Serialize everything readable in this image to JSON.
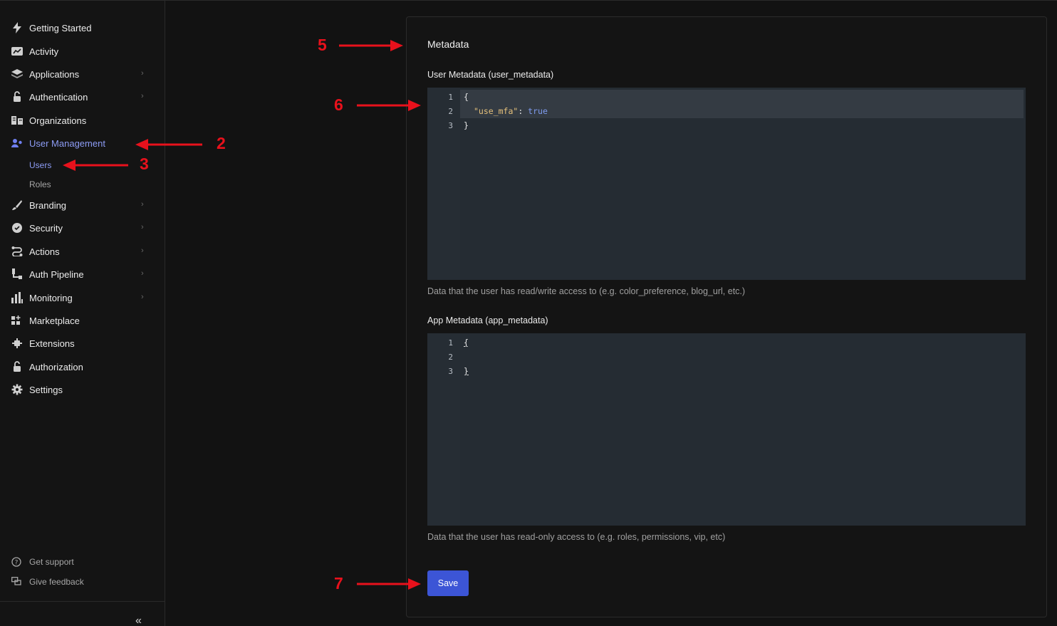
{
  "sidebar": {
    "items": [
      {
        "label": "Getting Started",
        "icon": "lightning-icon",
        "chevron": false,
        "active": false
      },
      {
        "label": "Activity",
        "icon": "activity-chart-icon",
        "chevron": false,
        "active": false
      },
      {
        "label": "Applications",
        "icon": "layers-icon",
        "chevron": true,
        "active": false
      },
      {
        "label": "Authentication",
        "icon": "lock-icon",
        "chevron": true,
        "active": false
      },
      {
        "label": "Organizations",
        "icon": "building-icon",
        "chevron": false,
        "active": false
      },
      {
        "label": "User Management",
        "icon": "users-icon",
        "chevron": false,
        "active": true
      },
      {
        "label": "Branding",
        "icon": "brush-icon",
        "chevron": true,
        "active": false
      },
      {
        "label": "Security",
        "icon": "shield-check-icon",
        "chevron": true,
        "active": false
      },
      {
        "label": "Actions",
        "icon": "flow-icon",
        "chevron": true,
        "active": false
      },
      {
        "label": "Auth Pipeline",
        "icon": "pipeline-icon",
        "chevron": true,
        "active": false
      },
      {
        "label": "Monitoring",
        "icon": "bar-chart-icon",
        "chevron": true,
        "active": false
      },
      {
        "label": "Marketplace",
        "icon": "grid-plus-icon",
        "chevron": false,
        "active": false
      },
      {
        "label": "Extensions",
        "icon": "puzzle-icon",
        "chevron": false,
        "active": false
      },
      {
        "label": "Authorization",
        "icon": "lock-icon",
        "chevron": false,
        "active": false
      },
      {
        "label": "Settings",
        "icon": "gear-icon",
        "chevron": false,
        "active": false
      }
    ],
    "sub_items": [
      {
        "label": "Users",
        "active": true
      },
      {
        "label": "Roles",
        "active": false
      }
    ],
    "footer": {
      "support_label": "Get support",
      "feedback_label": "Give feedback",
      "collapse_glyph": "«"
    }
  },
  "metadata": {
    "title": "Metadata",
    "user_metadata": {
      "label": "User Metadata (user_metadata)",
      "line_numbers": [
        "1",
        "2",
        "3"
      ],
      "line1": "{",
      "key": "\"use_mfa\"",
      "colon": ": ",
      "value": "true",
      "line3": "}",
      "helper": "Data that the user has read/write access to (e.g. color_preference, blog_url, etc.)"
    },
    "app_metadata": {
      "label": "App Metadata (app_metadata)",
      "line_numbers": [
        "1",
        "2",
        "3"
      ],
      "line1": "{",
      "line3": "}",
      "helper": "Data that the user has read-only access to (e.g. roles, permissions, vip, etc)"
    },
    "save_label": "Save"
  },
  "annotations": {
    "n2": "2",
    "n3": "3",
    "n5": "5",
    "n6": "6",
    "n7": "7"
  },
  "colors": {
    "accent": "#3c55d6",
    "active_nav": "#8d9cf5",
    "annotation": "#e8111c"
  }
}
